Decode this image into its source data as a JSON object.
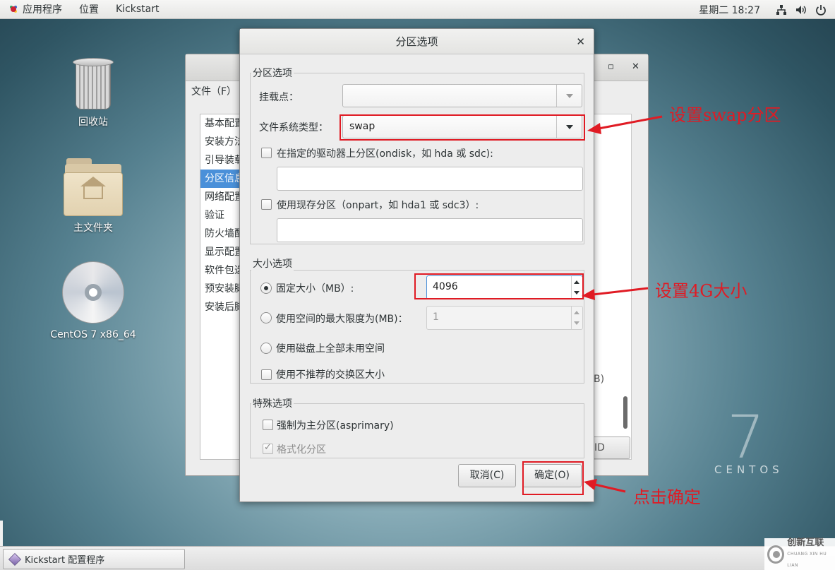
{
  "top_panel": {
    "applications": "应用程序",
    "places": "位置",
    "app_name": "Kickstart",
    "clock": "星期二 18:27"
  },
  "desktop": {
    "trash": "回收站",
    "home": "主文件夹",
    "cd": "CentOS 7 x86_64",
    "watermark_number": "7",
    "watermark_word": "CENTOS"
  },
  "bg_window": {
    "menu_file": "文件（F）",
    "sidebar_items": [
      "基本配置",
      "安装方法",
      "引导装载",
      "分区信息",
      "网络配置",
      "验证",
      "防火墙配置",
      "显示配置",
      "软件包选择",
      "预安装脚本",
      "安装后脚本"
    ],
    "right_text": "B)",
    "right_button": "ID"
  },
  "dialog": {
    "title": "分区选项",
    "partition_group": "分区选项",
    "mount_point_label": "挂载点：",
    "mount_point_value": "",
    "fs_type_label": "文件系统类型：",
    "fs_type_value": "swap",
    "ondisk_label": "在指定的驱动器上分区(ondisk，如 hda 或 sdc):",
    "ondisk_value": "",
    "onpart_label": "使用现存分区（onpart，如 hda1 或 sdc3）:",
    "onpart_value": "",
    "size_group": "大小选项",
    "fixed_size_label": "固定大小（MB）:",
    "fixed_size_value": "4096",
    "max_size_label": "使用空间的最大限度为(MB)：",
    "max_size_value": "1",
    "fill_disk_label": "使用磁盘上全部未用空间",
    "recommended_swap_label": "使用不推荐的交换区大小",
    "special_group": "特殊选项",
    "asprimary_label": "强制为主分区(asprimary)",
    "format_label": "格式化分区",
    "cancel": "取消(C)",
    "ok": "确定(O)"
  },
  "annotations": {
    "swap_note": "设置swap分区",
    "size_note": "设置4G大小",
    "ok_note": "点击确定",
    "color": "#e01b24"
  },
  "taskbar": {
    "task_label": "Kickstart 配置程序"
  },
  "brand": {
    "name": "创新互联",
    "sub": "CHUANG XIN HU LIAN"
  }
}
